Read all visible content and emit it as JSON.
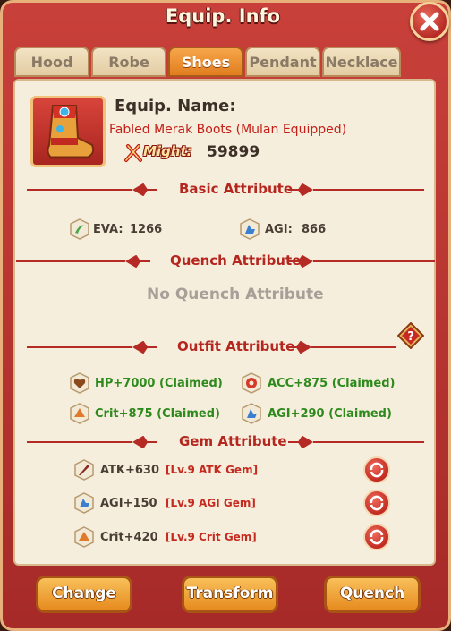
{
  "window": {
    "title": "Equip. Info"
  },
  "tabs": [
    {
      "label": "Hood",
      "active": false
    },
    {
      "label": "Robe",
      "active": false
    },
    {
      "label": "Shoes",
      "active": true
    },
    {
      "label": "Pendant",
      "active": false
    },
    {
      "label": "Necklace",
      "active": false
    }
  ],
  "equip": {
    "name_label": "Equip. Name:",
    "name": "Fabled Merak Boots  (Mulan Equipped)",
    "might_label": "Might:",
    "might_value": "59899",
    "icon": "boots-icon"
  },
  "basic": {
    "title": "Basic Attribute",
    "stats": [
      {
        "label": "EVA:",
        "value": "1266",
        "icon": "eva-icon"
      },
      {
        "label": "AGI:",
        "value": "866",
        "icon": "agi-icon"
      }
    ]
  },
  "quench": {
    "title": "Quench Attribute",
    "empty_text": "No Quench Attribute"
  },
  "outfit": {
    "title": "Outfit Attribute",
    "stats": [
      {
        "text": "HP+7000 (Claimed)",
        "icon": "hp-icon"
      },
      {
        "text": "ACC+875 (Claimed)",
        "icon": "acc-icon"
      },
      {
        "text": "Crit+875 (Claimed)",
        "icon": "crit-icon"
      },
      {
        "text": "AGI+290 (Claimed)",
        "icon": "agi-icon"
      }
    ]
  },
  "gem": {
    "title": "Gem Attribute",
    "rows": [
      {
        "stat": "ATK+630",
        "gem": "[Lv.9 ATK Gem]",
        "icon": "atk-icon"
      },
      {
        "stat": "AGI+150",
        "gem": "[Lv.9 AGI Gem]",
        "icon": "agi-icon"
      },
      {
        "stat": "Crit+420",
        "gem": "[Lv.9 Crit Gem]",
        "icon": "crit-icon"
      }
    ]
  },
  "buttons": {
    "change": "Change",
    "transform": "Transform",
    "quench": "Quench"
  },
  "colors": {
    "accent": "#b5261f",
    "claimed": "#2e8a1c",
    "gem_label": "#c62a1f"
  }
}
